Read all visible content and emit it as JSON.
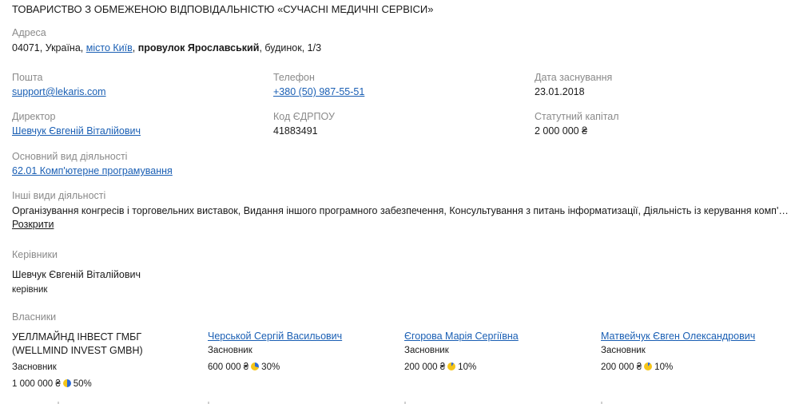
{
  "company": {
    "title": "ТОВАРИСТВО З ОБМЕЖЕНОЮ ВІДПОВІДАЛЬНІСТЮ «СУЧАСНІ МЕДИЧНІ СЕРВІСИ»"
  },
  "address": {
    "label": "Адреса",
    "prefix": "04071, Україна,",
    "city": "місто Київ",
    "comma": ",",
    "street": "провулок Ярославський",
    "suffix": ", будинок, 1/3"
  },
  "email": {
    "label": "Пошта",
    "value": "support@lekaris.com"
  },
  "phone": {
    "label": "Телефон",
    "value": "+380 (50) 987-55-51"
  },
  "founded": {
    "label": "Дата заснування",
    "value": "23.01.2018"
  },
  "director": {
    "label": "Директор",
    "value": "Шевчук Євгеній Віталійович"
  },
  "edrpou": {
    "label": "Код ЄДРПОУ",
    "value": "41883491"
  },
  "capital": {
    "label": "Статутний капітал",
    "value": "2 000 000 ₴"
  },
  "main_activity": {
    "label": "Основний вид діяльності",
    "value": "62.01 Комп'ютерне програмування"
  },
  "other_activities": {
    "label": "Інші види діяльності",
    "value": "Організування конгресів і торговельних виставок, Видання іншого програмного забезпечення, Консультування з питань інформатизації, Діяльність із керування комп'ютерним устаткуванням",
    "expand_label": "Розкрити"
  },
  "managers": {
    "label": "Керівники",
    "items": [
      {
        "name": "Шевчук Євгеній Віталійович",
        "role": "керівник"
      }
    ]
  },
  "owners": {
    "label": "Власники",
    "items": [
      {
        "name": "УЕЛЛМАЙНД ІНВЕСТ ГМБГ (WELLMIND INVEST GMBH)",
        "role": "Засновник",
        "amount": "1 000 000 ₴",
        "share": "50%",
        "share_fraction": 0.5
      },
      {
        "name": "Черськой Сергій Васильович",
        "role": "Засновник",
        "amount": "600 000 ₴",
        "share": "30%",
        "share_fraction": 0.3
      },
      {
        "name": "Єгорова Марія Сергіївна",
        "role": "Засновник",
        "amount": "200 000 ₴",
        "share": "10%",
        "share_fraction": 0.1
      },
      {
        "name": "Матвейчук Євген Олександрович",
        "role": "Засновник",
        "amount": "200 000 ₴",
        "share": "10%",
        "share_fraction": 0.1
      }
    ]
  },
  "colors": {
    "link": "#1a5fb4",
    "label": "#8a8a8a",
    "pie_blue": "#2d6bd6",
    "pie_yellow": "#f5c518"
  }
}
